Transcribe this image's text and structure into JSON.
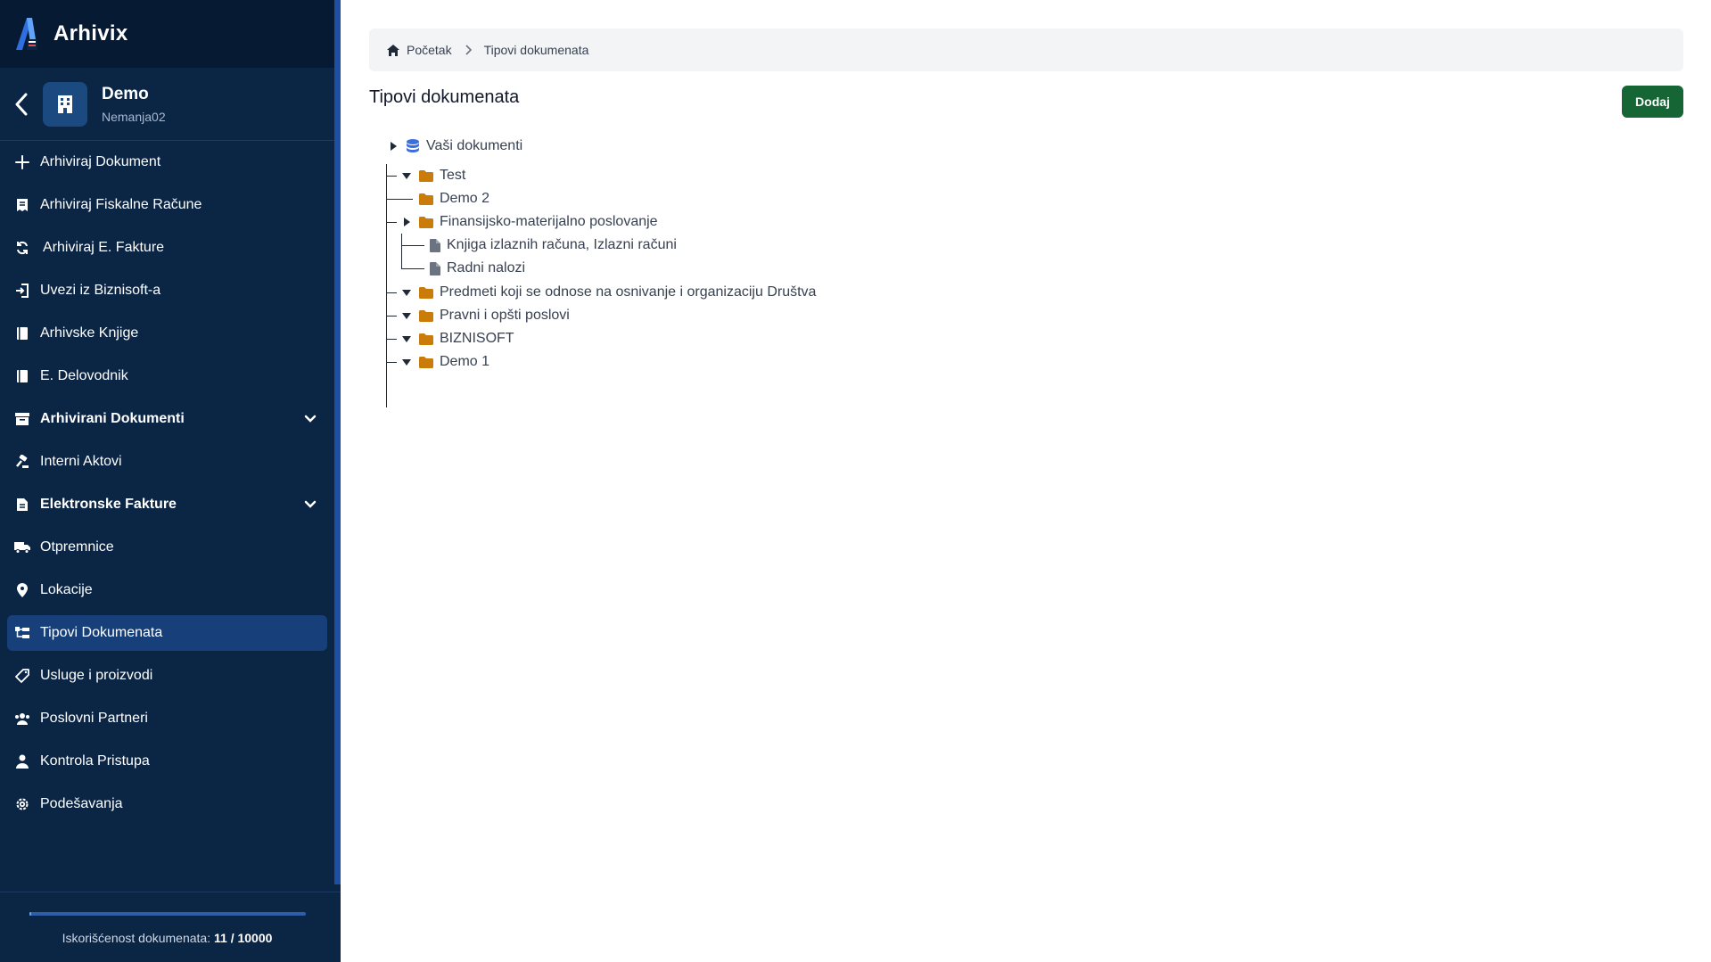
{
  "app": {
    "name": "Arhivix"
  },
  "org": {
    "name": "Demo",
    "user": "Nemanja02"
  },
  "colors": {
    "sidebar": "#0b2545",
    "active": "#17407a",
    "primary_button": "#166534",
    "folder": "#c97c0a"
  },
  "nav": [
    {
      "label": "Arhiviraj Dokument",
      "icon": "plus-icon"
    },
    {
      "label": "Arhiviraj Fiskalne Račune",
      "icon": "receipt-icon"
    },
    {
      "label": "Arhiviraj E. Fakture",
      "icon": "sync-icon"
    },
    {
      "label": "Uvezi iz Biznisoft-a",
      "icon": "import-icon"
    },
    {
      "label": "Arhivske Knjige",
      "icon": "book-icon"
    },
    {
      "label": "E. Delovodnik",
      "icon": "book-icon"
    },
    {
      "label": "Arhivirani Dokumenti",
      "icon": "archive-icon",
      "expandable": true
    },
    {
      "label": "Interni Aktovi",
      "icon": "gavel-icon"
    },
    {
      "label": "Elektronske Fakture",
      "icon": "invoice-icon",
      "expandable": true
    },
    {
      "label": "Otpremnice",
      "icon": "truck-icon"
    },
    {
      "label": "Lokacije",
      "icon": "map-pin-icon"
    },
    {
      "label": "Tipovi Dokumenata",
      "icon": "sitemap-icon",
      "active": true
    },
    {
      "label": "Usluge i proizvodi",
      "icon": "tag-icon"
    },
    {
      "label": "Poslovni Partneri",
      "icon": "users-icon"
    },
    {
      "label": "Kontrola Pristupa",
      "icon": "user-icon"
    },
    {
      "label": "Podešavanja",
      "icon": "gear-icon"
    }
  ],
  "usage": {
    "label": "Iskorišćenost dokumenata:",
    "value": "11 / 10000",
    "used": 11,
    "total": 10000
  },
  "breadcrumb": {
    "home": "Početak",
    "current": "Tipovi dokumenata"
  },
  "page": {
    "title": "Tipovi dokumenata",
    "add_label": "Dodaj"
  },
  "tree": {
    "root": "Vaši dokumenti",
    "nodes": [
      {
        "label": "Test",
        "type": "folder",
        "expanded": true
      },
      {
        "label": "Demo 2",
        "type": "folder"
      },
      {
        "label": "Finansijsko-materijalno poslovanje",
        "type": "folder",
        "expanded": false
      },
      {
        "label": "Knjiga izlaznih računa, Izlazni računi",
        "type": "file"
      },
      {
        "label": "Radni nalozi",
        "type": "file"
      },
      {
        "label": "Predmeti koji se odnose na osnivanje i organizaciju Društva",
        "type": "folder",
        "expanded": true
      },
      {
        "label": "Pravni i opšti poslovi",
        "type": "folder",
        "expanded": true
      },
      {
        "label": "BIZNISOFT",
        "type": "folder",
        "expanded": true
      },
      {
        "label": "Demo 1",
        "type": "folder",
        "expanded": true
      }
    ]
  }
}
